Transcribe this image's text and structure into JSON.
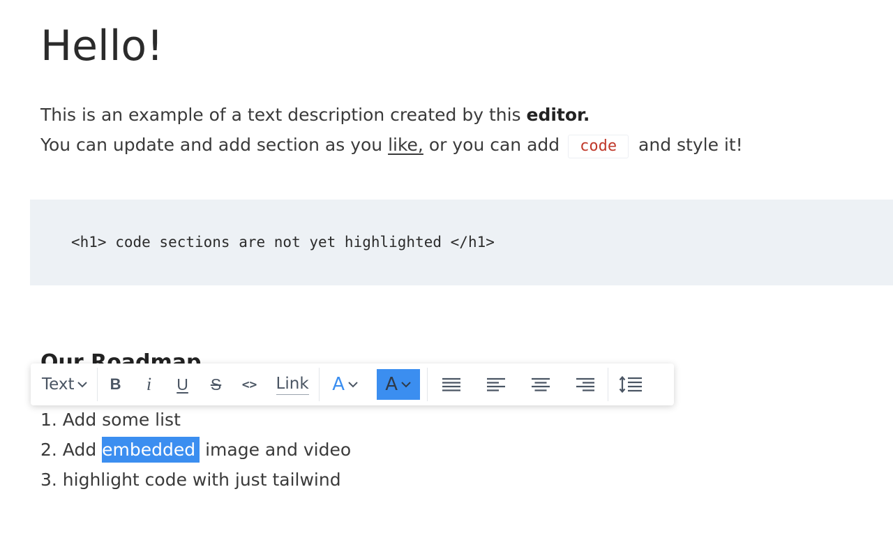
{
  "content": {
    "title": "Hello!",
    "paragraph": {
      "line1_text": "This is an example of a text description created by this ",
      "line1_bold": "editor.",
      "line2_before": "You can update and add section as you ",
      "line2_link": "like,",
      "line2_middle": " or you can add ",
      "inline_code": "code",
      "line2_after": " and style it!"
    },
    "code_block": "<h1> code sections are not yet highlighted </h1>",
    "section_heading": "Our Roadmap",
    "list": [
      {
        "prefix": "1. Add some list",
        "selected": "",
        "suffix": ""
      },
      {
        "prefix": "2. Add ",
        "selected": "embedded",
        "suffix": " image and video"
      },
      {
        "prefix": "3. highlight code with just tailwind",
        "selected": "",
        "suffix": ""
      }
    ]
  },
  "toolbar": {
    "text_style_label": "Text",
    "bold_label": "B",
    "italic_label": "i",
    "underline_label": "U",
    "strike_label": "S",
    "code_label": "<>",
    "link_label": "Link",
    "text_color_label": "A",
    "bg_color_label": "A",
    "accent_color": "#3b8ef0",
    "icons": [
      "chevron-down-icon",
      "align-justify-icon",
      "align-left-icon",
      "align-center-icon",
      "align-right-icon",
      "line-height-icon"
    ]
  }
}
